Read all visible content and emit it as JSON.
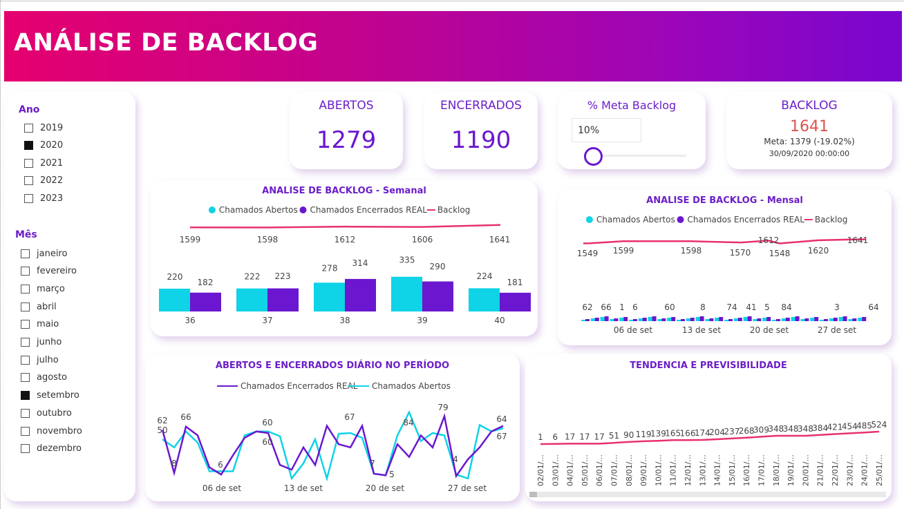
{
  "header": {
    "title": "ANÁLISE DE BACKLOG"
  },
  "filters": {
    "year": {
      "title": "Ano",
      "items": [
        {
          "label": "2019",
          "checked": false
        },
        {
          "label": "2020",
          "checked": true
        },
        {
          "label": "2021",
          "checked": false
        },
        {
          "label": "2022",
          "checked": false
        },
        {
          "label": "2023",
          "checked": false
        }
      ]
    },
    "month": {
      "title": "Mês",
      "items": [
        {
          "label": "janeiro",
          "checked": false
        },
        {
          "label": "fevereiro",
          "checked": false
        },
        {
          "label": "março",
          "checked": false
        },
        {
          "label": "abril",
          "checked": false
        },
        {
          "label": "maio",
          "checked": false
        },
        {
          "label": "junho",
          "checked": false
        },
        {
          "label": "julho",
          "checked": false
        },
        {
          "label": "agosto",
          "checked": false
        },
        {
          "label": "setembro",
          "checked": true
        },
        {
          "label": "outubro",
          "checked": false
        },
        {
          "label": "novembro",
          "checked": false
        },
        {
          "label": "dezembro",
          "checked": false
        }
      ]
    }
  },
  "kpis": {
    "abertos": {
      "label": "ABERTOS",
      "value": "1279"
    },
    "encerrados": {
      "label": "ENCERRADOS",
      "value": "1190"
    },
    "meta": {
      "label": "% Meta Backlog",
      "input_value": "10%",
      "slider_fraction": 0.1
    },
    "backlog": {
      "label": "BACKLOG",
      "value": "1641",
      "meta_text": "Meta: 1379 (-19.02%)",
      "date": "30/09/2020 00:00:00"
    }
  },
  "colors": {
    "abertos": "#0fd3e6",
    "encerrados": "#6a17cf",
    "backlog": "#e8306f",
    "title": "#6b1fc8"
  },
  "chart_data": [
    {
      "type": "bar",
      "title": "ANALISE DE BACKLOG - Semanal",
      "categories": [
        "36",
        "37",
        "38",
        "39",
        "40"
      ],
      "series": [
        {
          "name": "Chamados Abertos",
          "values": [
            220,
            222,
            278,
            335,
            224
          ]
        },
        {
          "name": "Chamados Encerrados REAL",
          "values": [
            182,
            223,
            314,
            290,
            181
          ]
        },
        {
          "name": "Backlog",
          "type": "line",
          "values": [
            1599,
            1598,
            1612,
            1606,
            1641
          ]
        }
      ]
    },
    {
      "type": "bar",
      "title": "ANALISE DE BACKLOG - Mensal",
      "x_ticks": [
        "06 de set",
        "13 de set",
        "20 de set",
        "27 de set"
      ],
      "series": [
        {
          "name": "Chamados Abertos",
          "values": [
            62,
            66,
            1,
            6,
            60,
            8,
            74,
            41,
            5,
            84,
            3,
            64
          ]
        },
        {
          "name": "Chamados Encerrados REAL",
          "values": []
        },
        {
          "name": "Backlog",
          "type": "line",
          "values": [
            1549,
            1599,
            1598,
            1570,
            1612,
            1548,
            1620,
            1641
          ]
        }
      ]
    },
    {
      "type": "line",
      "title": "ABERTOS E ENCERRADOS DIÁRIO NO PERÍODO",
      "x_ticks": [
        "06 de set",
        "13 de set",
        "20 de set",
        "27 de set"
      ],
      "point_labels": [
        "62",
        "50",
        "8",
        "66",
        "6",
        "60",
        "60",
        "67",
        "84",
        "7",
        "5",
        "79",
        "4",
        "64",
        "67"
      ],
      "series": [
        {
          "name": "Chamados Encerrados REAL",
          "values": [
            62,
            8,
            66,
            55,
            15,
            6,
            30,
            52,
            60,
            58,
            18,
            12,
            40,
            18,
            67,
            44,
            40,
            67,
            7,
            5,
            44,
            28,
            55,
            40,
            79,
            4,
            25,
            40,
            60,
            67
          ]
        },
        {
          "name": "Chamados Abertos",
          "values": [
            50,
            40,
            60,
            46,
            10,
            10,
            10,
            55,
            60,
            60,
            54,
            1,
            20,
            50,
            1,
            57,
            58,
            52,
            7,
            5,
            55,
            84,
            48,
            58,
            55,
            6,
            1,
            68,
            60,
            64
          ]
        }
      ]
    },
    {
      "type": "line",
      "title": "TENDENCIA E PREVISIBILIDADE",
      "categories": [
        "02/01/...",
        "03/01/...",
        "04/01/...",
        "05/01/...",
        "06/01/...",
        "07/01/...",
        "08/01/...",
        "09/01/...",
        "10/01/...",
        "11/01/...",
        "12/01/...",
        "13/01/...",
        "14/01/...",
        "15/01/...",
        "16/01/...",
        "17/01/...",
        "18/01/...",
        "19/01/...",
        "20/01/...",
        "21/01/...",
        "22/01/...",
        "23/01/...",
        "24/01/...",
        "25/01/..."
      ],
      "values": [
        1,
        6,
        17,
        17,
        17,
        51,
        90,
        119,
        139,
        165,
        166,
        174,
        204,
        237,
        268,
        309,
        348,
        348,
        348,
        384,
        421,
        454,
        485,
        524
      ]
    }
  ]
}
